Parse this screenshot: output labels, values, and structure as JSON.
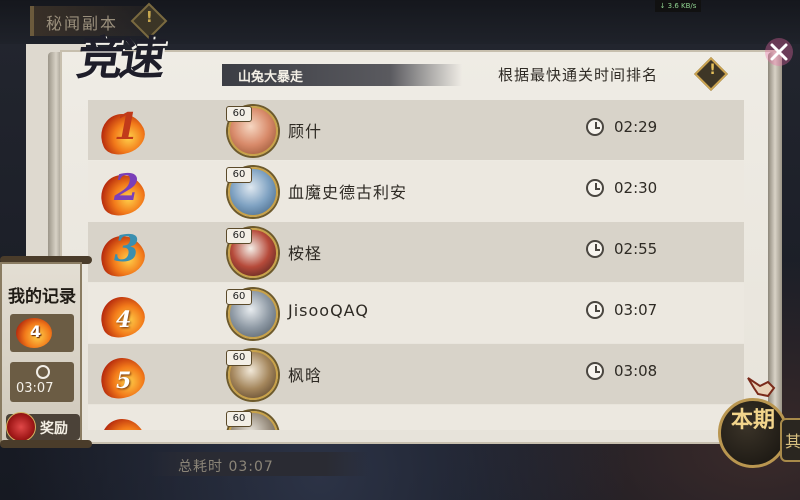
{
  "header": {
    "dungeon_title": "秘闻副本",
    "net_speed": "↓ 3.6 KB/s"
  },
  "panel": {
    "brand_title": "竞速",
    "stage_name": "山兔大暴走",
    "rank_hint": "根据最快通关时间排名"
  },
  "leaderboard": [
    {
      "rank": "1",
      "level": "60",
      "name": "顾什",
      "time": "02:29",
      "rank_color": "#c13a1a"
    },
    {
      "rank": "2",
      "level": "60",
      "name": "血魔史德古利安",
      "time": "02:30",
      "rank_color": "#7a3fb8"
    },
    {
      "rank": "3",
      "level": "60",
      "name": "桉柽",
      "time": "02:55",
      "rank_color": "#3a8fb0"
    },
    {
      "rank": "4",
      "level": "60",
      "name": "JisooQAQ",
      "time": "03:07",
      "rank_color": "#ffffff"
    },
    {
      "rank": "5",
      "level": "60",
      "name": "枫晗",
      "time": "03:08",
      "rank_color": "#ffffff"
    },
    {
      "rank": "",
      "level": "60",
      "name": "",
      "time": "",
      "rank_color": "#ffffff"
    }
  ],
  "my_record": {
    "title": "我的记录",
    "rank": "4",
    "time": "03:07",
    "reward_label": "奖励"
  },
  "footer": {
    "total_time": "总耗时 03:07",
    "period_label": "本期",
    "period_label_2": "其"
  },
  "icons": {
    "warning": "!",
    "close": "close-icon",
    "clock": "clock-icon"
  }
}
